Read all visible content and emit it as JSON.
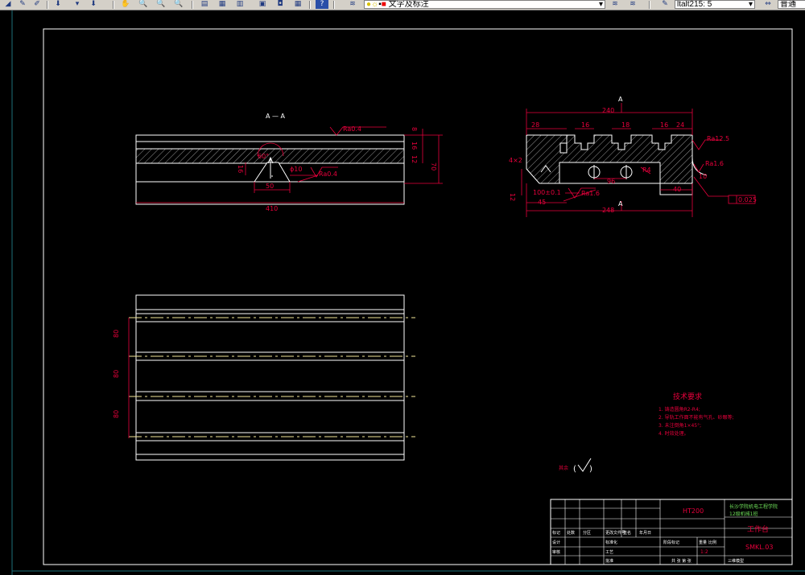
{
  "toolbar": {
    "layer_name": "文字及标注",
    "text_style": "ltalt215: 5",
    "dim_style": "普通"
  },
  "drawing": {
    "section_label": "A — A",
    "section_arrow_label": "A",
    "left_view": {
      "dim_overall_length": "410",
      "dim_slot_width": "50",
      "dim_height": "70",
      "dim_top": "8",
      "dim_mid": "16",
      "dim_low": "12",
      "dim_slot_depth": "16",
      "dim_angle": "60°",
      "dim_small": "ϕ10",
      "roughness_top": "Ra0.4",
      "roughness_slot": "Ra0.4"
    },
    "right_view": {
      "dim_top": "240",
      "dim_bottom": "248",
      "dim_left": "28",
      "dim_t1": "16",
      "dim_t2": "18",
      "dim_t3": "16",
      "dim_t4": "24",
      "dim_96": "96",
      "dim_40": "40",
      "dim_45": "45",
      "dim_4x2": "4×2",
      "dim_12": "12",
      "dim_100": "100±0.1",
      "dim_R": "R4",
      "dim_10": "10",
      "roughness_1": "Ra12.5",
      "roughness_2": "Ra1.6",
      "roughness_3": "Ra1.6",
      "tolerance": "0.025"
    },
    "plan_view": {
      "dim_1": "80",
      "dim_2": "80",
      "dim_3": "80"
    },
    "tech_req": {
      "title": "技术要求",
      "items": [
        "1. 铸造圆角R2-R4;",
        "2. 导轨工作面不能有气孔、砂眼等;",
        "3. 未注倒角1×45°;",
        "4. 时效处理。"
      ]
    },
    "remaining_roughness": "其余"
  },
  "title_block": {
    "material": "HT200",
    "school_line1": "长沙学院机电工程学院",
    "school_line2": "12级机械1班",
    "part_name": "工作台",
    "drawing_no": "SMKL.03",
    "scale": "1:2",
    "row_labels": [
      "标记",
      "处数",
      "分区",
      "更改文件号",
      "签名",
      "年月日"
    ],
    "design_label": "设计",
    "std_label": "标准化",
    "check_label": "审核",
    "process_label": "工艺",
    "approve_label": "批准",
    "stage_label": "阶段标记",
    "weight_label": "重量",
    "scale_label": "比例",
    "sheets_label": "共 张 第 张",
    "projection_label": "三维模型"
  }
}
